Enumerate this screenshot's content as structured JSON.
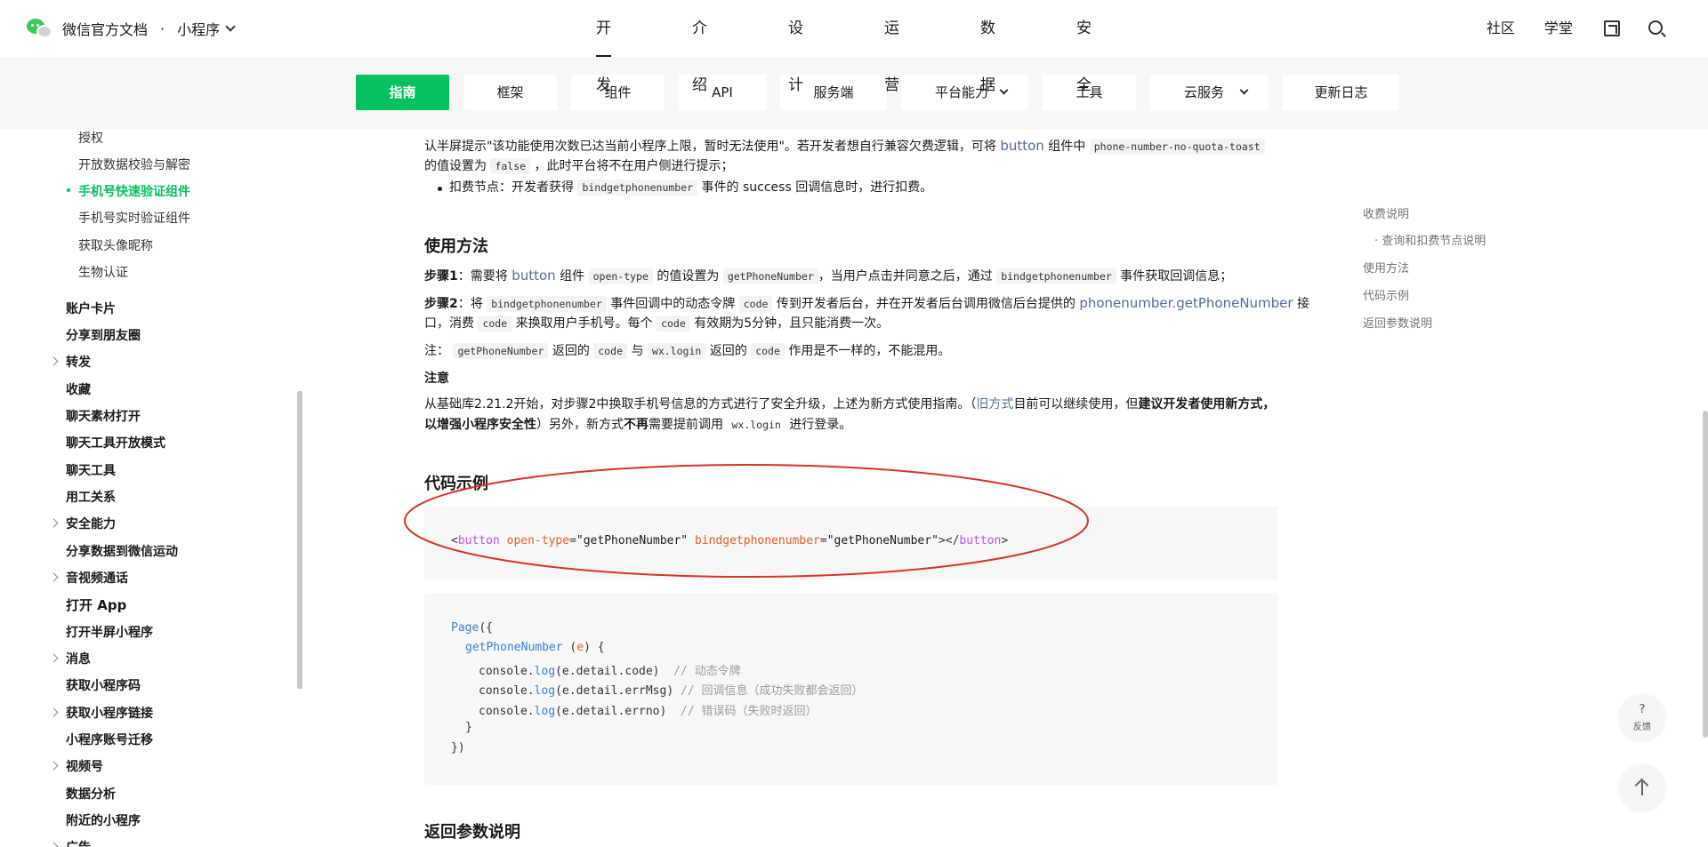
{
  "header": {
    "brand_title": "微信官方文档",
    "brand_dot": "·",
    "brand_sub": "小程序",
    "nav": [
      "开发",
      "介绍",
      "设计",
      "运营",
      "数据",
      "安全"
    ],
    "right": [
      "社区",
      "学堂"
    ]
  },
  "subnav": {
    "tabs": [
      "指南",
      "框架",
      "组件",
      "API",
      "服务端",
      "平台能力",
      "工具",
      "云服务",
      "更新日志"
    ],
    "accent": "#07c160"
  },
  "sidebar": {
    "items": [
      "授权",
      "开放数据校验与解密",
      "手机号快速验证组件",
      "手机号实时验证组件",
      "获取头像昵称",
      "生物认证",
      "账户卡片",
      "分享到朋友圈",
      "转发",
      "收藏",
      "聊天素材打开",
      "聊天工具开放模式",
      "聊天工具",
      "用工关系",
      "安全能力",
      "分享数据到微信运动",
      "音视频通话",
      "打开 App",
      "打开半屏小程序",
      "消息",
      "获取小程序码",
      "获取小程序链接",
      "小程序账号迁移",
      "视频号",
      "数据分析",
      "附近的小程序",
      "广告"
    ]
  },
  "content": {
    "top_frag_1a": "认半屏提示\"该功能使用次数已达当前小程序上限，暂时无法使用\"。若开发者想自行兼容欠费逻辑，可将",
    "top_frag_1b": "button",
    "top_frag_1c": "组件中",
    "top_frag_1d": "phone-number-no-quota-toast",
    "top_frag_2a": "的值设置为",
    "top_frag_2b": "false",
    "top_frag_2c": "，此时平台将不在用户侧进行提示；",
    "bullet2_a": "扣费节点：开发者获得",
    "bullet2_b": "bindgetphonenumber",
    "bullet2_c": "事件的",
    "bullet2_d": "success",
    "bullet2_e": "回调信息时，进行扣费。",
    "usage_title": "使用方法",
    "step1_label": "步骤1",
    "step1_a": "：需要将",
    "step1_b": "button",
    "step1_c": "组件",
    "step1_d": "open-type",
    "step1_e": "的值设置为",
    "step1_f": "getPhoneNumber",
    "step1_g": "，当用户点击并同意之后，通过",
    "step1_h": "bindgetphonenumber",
    "step1_i": "事件获取回调信息；",
    "step2_label": "步骤2",
    "step2_a": "：将",
    "step2_b": "bindgetphonenumber",
    "step2_c": "事件回调中的动态令牌",
    "step2_d": "code",
    "step2_e": "传到开发者后台，并在开发者后台调用微信后台提供的",
    "step2_f": "phonenumber.getPhoneNumber",
    "step2_g": "接",
    "step2_h": "口，消费",
    "step2_i": "code",
    "step2_j": "来换取用户手机号。每个",
    "step2_k": "code",
    "step2_l": "有效期为5分钟，且只能消费一次。",
    "note_a": "注：",
    "note_b": "getPhoneNumber",
    "note_c": "返回的",
    "note_d": "code",
    "note_e": "与",
    "note_f": "wx.login",
    "note_g": "返回的",
    "note_h": "code",
    "note_i": "作用是不一样的，不能混用。",
    "notice_title": "注意",
    "notice_a": "从基础库2.21.2开始，对步骤2中换取手机号信息的方式进行了安全升级，上述为新方式使用指南。（",
    "notice_b": "旧方式",
    "notice_c": "目前可以继续使用，但",
    "notice_d": "建议开发者使用新方式，",
    "notice_e": "以增强小程序安全性",
    "notice_f": "）另外，新方式",
    "notice_g": "不再",
    "notice_h": "需要提前调用",
    "notice_i": "wx.login",
    "notice_j": "进行登录。",
    "code_title": "代码示例",
    "return_title": "返回参数说明"
  },
  "code1": {
    "lt": "<",
    "tag": "button",
    "attr1": "open-type",
    "eq1": "=",
    "val1": "\"getPhoneNumber\"",
    "attr2": "bindgetphonenumber",
    "eq2": "=",
    "val2": "\"getPhoneNumber\"",
    "close_open": "></",
    "close_tag": "button",
    "gt": ">"
  },
  "code2": {
    "l1_fn": "Page",
    "l1_rest": "({",
    "l2_fn": "getPhoneNumber",
    "l2_open": " (",
    "l2_param": "e",
    "l2_close": ") {",
    "l3_obj": "console.",
    "l3_fn": "log",
    "l3_args": "(e.detail.code)",
    "l3_comment": "// 动态令牌",
    "l4_obj": "console.",
    "l4_fn": "log",
    "l4_args": "(e.detail.errMsg)",
    "l4_comment": "// 回调信息（成功失败都会返回）",
    "l5_obj": "console.",
    "l5_fn": "log",
    "l5_args": "(e.detail.errno)",
    "l5_comment": "// 错误码（失败时返回）",
    "l6": "}",
    "l7": "})"
  },
  "toc": {
    "items": [
      "收费说明",
      "· 查询和扣费节点说明",
      "使用方法",
      "代码示例",
      "返回参数说明"
    ]
  },
  "float": {
    "help_q": "?",
    "help_label": "反馈"
  },
  "colors": {
    "accent": "#07c160",
    "link": "#576b95",
    "annotation": "#d9332b"
  }
}
